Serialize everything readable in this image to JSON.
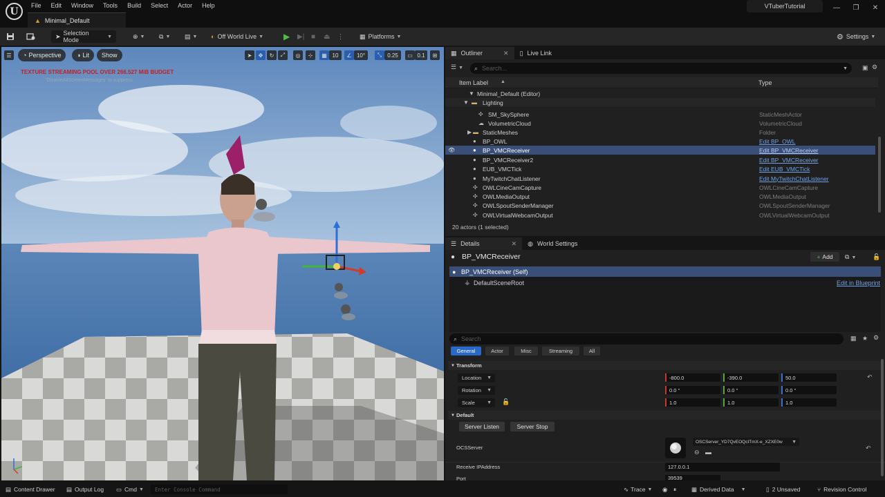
{
  "menu": {
    "items": [
      "File",
      "Edit",
      "Window",
      "Tools",
      "Build",
      "Select",
      "Actor",
      "Help"
    ],
    "level_tab": "Minimal_Default",
    "project_name": "VTuberTutorial"
  },
  "toolbar": {
    "selection_mode": "Selection Mode",
    "net_mode": "Off World Live",
    "platforms": "Platforms",
    "settings": "Settings"
  },
  "viewport": {
    "perspective": "Perspective",
    "lit": "Lit",
    "show": "Show",
    "grid_snap": "10",
    "rot_snap": "10°",
    "scale_snap": "0.25",
    "cam_speed": "0.1",
    "warning": "TEXTURE STREAMING POOL OVER 266.527 MiB BUDGET",
    "warning_sub": "'DisableAllScreenMessages' to suppress"
  },
  "outliner": {
    "tab": "Outliner",
    "tab2": "Live Link",
    "search_placeholder": "Search...",
    "col_label": "Item Label",
    "col_type": "Type",
    "rows": [
      {
        "label": "Minimal_Default (Editor)",
        "type": ""
      },
      {
        "label": "Lighting",
        "type": ""
      },
      {
        "label": "SM_SkySphere",
        "type": "StaticMeshActor"
      },
      {
        "label": "VolumetricCloud",
        "type": "VolumetricCloud"
      },
      {
        "label": "StaticMeshes",
        "type": "Folder"
      },
      {
        "label": "BP_OWL",
        "type": "Edit BP_OWL"
      },
      {
        "label": "BP_VMCReceiver",
        "type": "Edit BP_VMCReceiver"
      },
      {
        "label": "BP_VMCReceiver2",
        "type": "Edit BP_VMCReceiver"
      },
      {
        "label": "EUB_VMCTick",
        "type": "Edit EUB_VMCTick"
      },
      {
        "label": "MyTwitchChatListener",
        "type": "Edit MyTwitchChatListener"
      },
      {
        "label": "OWLCineCamCapture",
        "type": "OWLCineCamCapture"
      },
      {
        "label": "OWLMediaOutput",
        "type": "OWLMediaOutput"
      },
      {
        "label": "OWLSpoutSenderManager",
        "type": "OWLSpoutSenderManager"
      },
      {
        "label": "OWLVirtualWebcamOutput",
        "type": "OWLVirtualWebcamOutput"
      }
    ],
    "actor_count": "20 actors (1 selected)"
  },
  "details": {
    "tab": "Details",
    "tab2": "World Settings",
    "actor_name": "BP_VMCReceiver",
    "add_label": "Add",
    "self_label": "BP_VMCReceiver (Self)",
    "root_label": "DefaultSceneRoot",
    "edit_blueprint": "Edit in Blueprint",
    "search_placeholder": "Search",
    "filters": [
      "General",
      "Actor",
      "Misc",
      "Streaming",
      "All"
    ],
    "transform_label": "Transform",
    "location_label": "Location",
    "rotation_label": "Rotation",
    "scale_label": "Scale",
    "location": [
      "-800.0",
      "-390.0",
      "50.0"
    ],
    "rotation": [
      "0.0 °",
      "0.0 °",
      "0.0 °"
    ],
    "scale": [
      "1.0",
      "1.0",
      "1.0"
    ],
    "default_label": "Default",
    "server_listen": "Server Listen",
    "server_stop": "Server Stop",
    "ocs_label": "OCSServer",
    "ocs_value": "OSCServer_YD7QvEOQctTmX-e_XZXE0w",
    "ip_label": "Receive IPAddress",
    "ip_value": "127.0.0.1",
    "port_label": "Port",
    "port_value": "39539"
  },
  "status": {
    "content_drawer": "Content Drawer",
    "output_log": "Output Log",
    "cmd": "Cmd",
    "console_placeholder": "Enter Console Command",
    "trace": "Trace",
    "derived_data": "Derived Data",
    "unsaved": "2 Unsaved",
    "revision": "Revision Control"
  }
}
